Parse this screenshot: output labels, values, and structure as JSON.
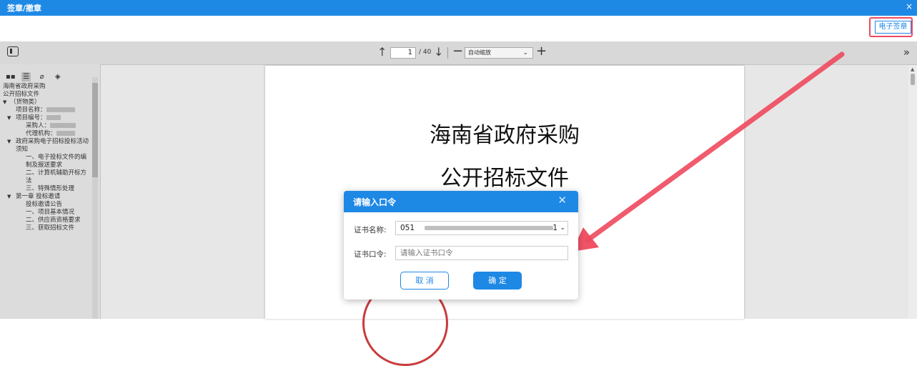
{
  "window": {
    "title": "签章/撤章",
    "close": "×"
  },
  "actions": {
    "esign_label": "电子签章"
  },
  "pdf_toolbar": {
    "page_current": "1",
    "page_total": "/ 40",
    "zoom": "自动缩放"
  },
  "outline": [
    {
      "label": "海南省政府采购",
      "indent": 4,
      "arrow": ""
    },
    {
      "label": "公开招标文件",
      "indent": 4,
      "arrow": ""
    },
    {
      "label": "（货物类）",
      "indent": 4,
      "arrow": "▼"
    },
    {
      "label": "项目名称：",
      "indent": 22,
      "arrow": ""
    },
    {
      "label": "项目编号：",
      "indent": 22,
      "arrow": "▼"
    },
    {
      "label": "采购人：",
      "indent": 36,
      "arrow": ""
    },
    {
      "label": "代理机构：",
      "indent": 36,
      "arrow": ""
    },
    {
      "label": "政府采购电子招标投标活动须知",
      "indent": 22,
      "arrow": "▼"
    },
    {
      "label": "一、电子投标文件的编制及报送要求",
      "indent": 36,
      "arrow": ""
    },
    {
      "label": "二、计算机辅助开标方法",
      "indent": 36,
      "arrow": ""
    },
    {
      "label": "三、特殊情形处理",
      "indent": 36,
      "arrow": ""
    },
    {
      "label": "第一章 投标邀请",
      "indent": 22,
      "arrow": "▼"
    },
    {
      "label": "投标邀请公告",
      "indent": 36,
      "arrow": ""
    },
    {
      "label": "一、项目基本情况",
      "indent": 36,
      "arrow": ""
    },
    {
      "label": "二、供应商资格要求",
      "indent": 36,
      "arrow": ""
    },
    {
      "label": "三、获取招标文件",
      "indent": 36,
      "arrow": ""
    }
  ],
  "document": {
    "line1": "海南省政府采购",
    "line2": "公开招标文件"
  },
  "dialog": {
    "title": "请输入口令",
    "close": "✕",
    "cert_name_label": "证书名称:",
    "cert_name_value_start": "051",
    "cert_name_value_end": "1",
    "password_label": "证书口令:",
    "password_placeholder": "请输入证书口令",
    "cancel": "取 消",
    "ok": "确 定"
  },
  "colors": {
    "primary": "#1e88e5",
    "annotation": "#ef4a5e"
  }
}
